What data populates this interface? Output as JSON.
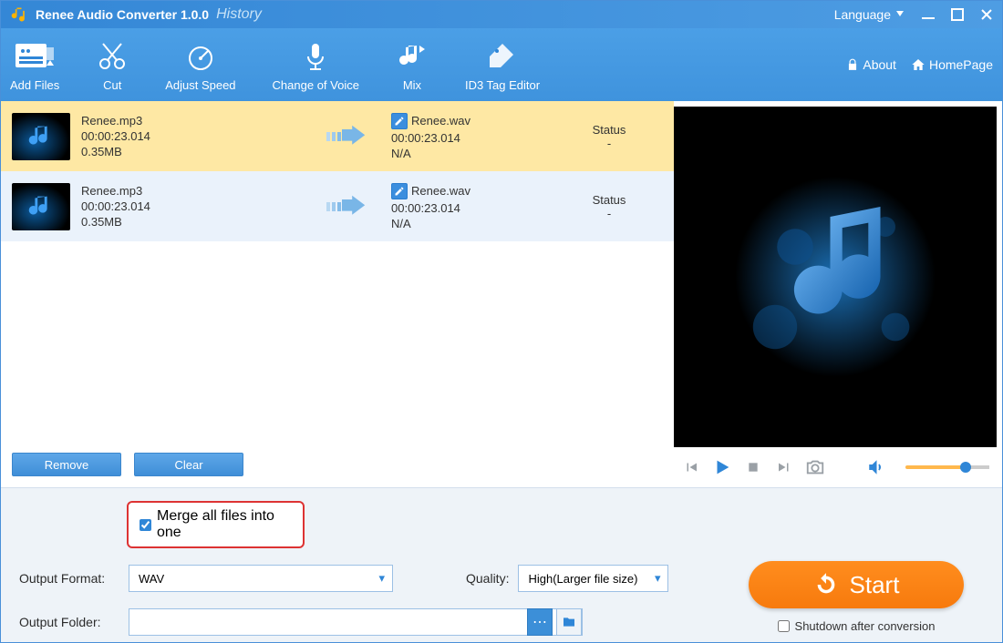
{
  "app": {
    "title": "Renee Audio Converter 1.0.0",
    "history": "History",
    "language_label": "Language"
  },
  "toolbar": {
    "add_files": "Add Files",
    "cut": "Cut",
    "adjust_speed": "Adjust Speed",
    "change_of_voice": "Change of Voice",
    "mix": "Mix",
    "id3": "ID3 Tag Editor",
    "about": "About",
    "homepage": "HomePage"
  },
  "list": {
    "items": [
      {
        "src_name": "Renee.mp3",
        "src_duration": "00:00:23.014",
        "src_size": "0.35MB",
        "dst_name": "Renee.wav",
        "dst_duration": "00:00:23.014",
        "dst_size": "N/A",
        "status_label": "Status",
        "status_value": "-"
      },
      {
        "src_name": "Renee.mp3",
        "src_duration": "00:00:23.014",
        "src_size": "0.35MB",
        "dst_name": "Renee.wav",
        "dst_duration": "00:00:23.014",
        "dst_size": "N/A",
        "status_label": "Status",
        "status_value": "-"
      }
    ],
    "remove": "Remove",
    "clear": "Clear"
  },
  "settings": {
    "merge_label": "Merge all files into one",
    "output_format_label": "Output Format:",
    "output_format_value": "WAV",
    "quality_label": "Quality:",
    "quality_value": "High(Larger file size)",
    "output_folder_label": "Output Folder:",
    "output_folder_value": ""
  },
  "actions": {
    "start": "Start",
    "shutdown": "Shutdown after conversion"
  }
}
